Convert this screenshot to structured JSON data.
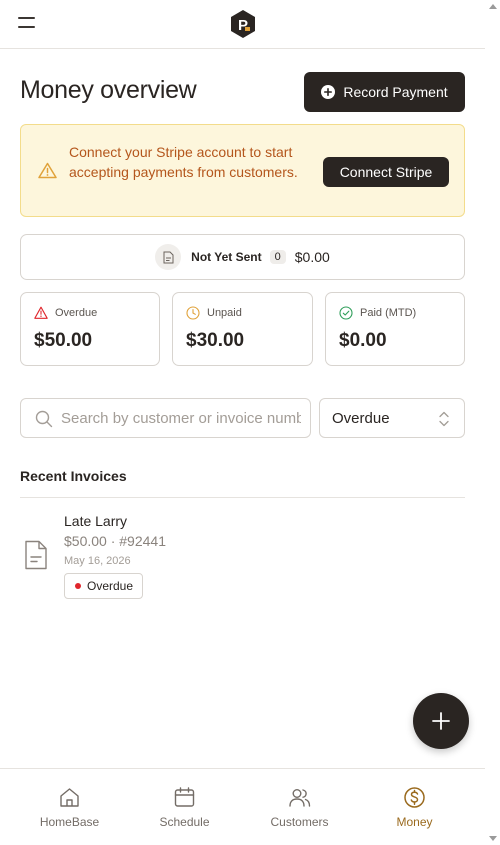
{
  "header": {
    "logo": "P"
  },
  "page": {
    "title": "Money overview"
  },
  "actions": {
    "record_payment": "Record Payment"
  },
  "banner": {
    "message": "Connect your Stripe account to start accepting payments from customers.",
    "button": "Connect Stripe"
  },
  "not_yet_sent": {
    "label": "Not Yet Sent",
    "count": "0",
    "amount": "$0.00"
  },
  "stats": [
    {
      "label": "Overdue",
      "value": "$50.00"
    },
    {
      "label": "Unpaid",
      "value": "$30.00"
    },
    {
      "label": "Paid (MTD)",
      "value": "$0.00"
    }
  ],
  "search": {
    "placeholder": "Search by customer or invoice number",
    "value": ""
  },
  "filter": {
    "selected": "Overdue"
  },
  "recent": {
    "title": "Recent Invoices",
    "invoices": [
      {
        "customer": "Late Larry",
        "meta": "$50.00 · #92441",
        "date": "May 16, 2026",
        "status": "Overdue"
      }
    ]
  },
  "nav": [
    {
      "label": "HomeBase"
    },
    {
      "label": "Schedule"
    },
    {
      "label": "Customers"
    },
    {
      "label": "Money"
    }
  ],
  "colors": {
    "primary_dark": "#2a2522",
    "accent_gold": "#9a6a1e",
    "warning_bg": "#fdf6dc",
    "warning_text": "#b4561c",
    "overdue_red": "#e0262c",
    "unpaid_amber": "#e0a23a",
    "paid_green": "#2f9e5a"
  },
  "icons": {
    "menu": "hamburger-icon",
    "record": "plus-circle-icon",
    "warning": "warning-triangle-icon",
    "document": "document-icon",
    "overdue": "alert-triangle-icon",
    "unpaid": "clock-icon",
    "paid": "check-circle-icon",
    "search": "search-icon",
    "select": "chevron-updown-icon",
    "fab": "plus-icon",
    "nav_home": "home-icon",
    "nav_schedule": "calendar-icon",
    "nav_customers": "users-icon",
    "nav_money": "dollar-circle-icon"
  }
}
